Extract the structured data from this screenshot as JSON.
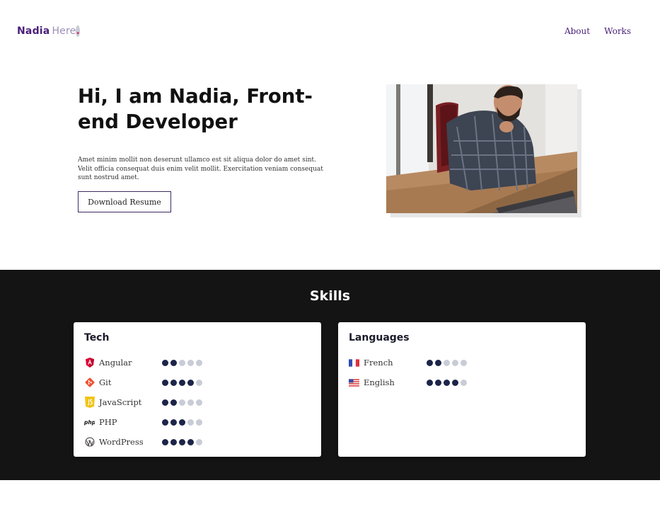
{
  "header": {
    "logo_first": "Nadia",
    "logo_second": "Here",
    "logo_dot": ".",
    "nav": [
      {
        "label": "About"
      },
      {
        "label": "Works"
      }
    ]
  },
  "hero": {
    "title": "Hi, I am Nadia, Front-end Developer",
    "text": "Amet minim mollit non deserunt ullamco est sit aliqua dolor do amet sint. Velit officia consequat duis enim velit mollit. Exercitation veniam consequat sunt nostrud amet.",
    "button_label": "Download Resume"
  },
  "skills": {
    "title": "Skills",
    "tech": {
      "title": "Tech",
      "items": [
        {
          "label": "Angular",
          "icon": "angular-icon",
          "level": 2,
          "max": 5
        },
        {
          "label": "Git",
          "icon": "git-icon",
          "level": 4,
          "max": 5
        },
        {
          "label": "JavaScript",
          "icon": "javascript-icon",
          "level": 2,
          "max": 5
        },
        {
          "label": "PHP",
          "icon": "php-icon",
          "level": 3,
          "max": 5
        },
        {
          "label": "WordPress",
          "icon": "wordpress-icon",
          "level": 4,
          "max": 5
        }
      ]
    },
    "languages": {
      "title": "Languages",
      "items": [
        {
          "label": "French",
          "icon": "france-flag-icon",
          "level": 2,
          "max": 5
        },
        {
          "label": "English",
          "icon": "us-flag-icon",
          "level": 4,
          "max": 5
        }
      ]
    }
  },
  "colors": {
    "brand": "#4a1f7a",
    "accent": "#e0245e",
    "dark_section": "#141414",
    "dot_on": "#1c2449",
    "dot_off": "#c8ccd6"
  }
}
